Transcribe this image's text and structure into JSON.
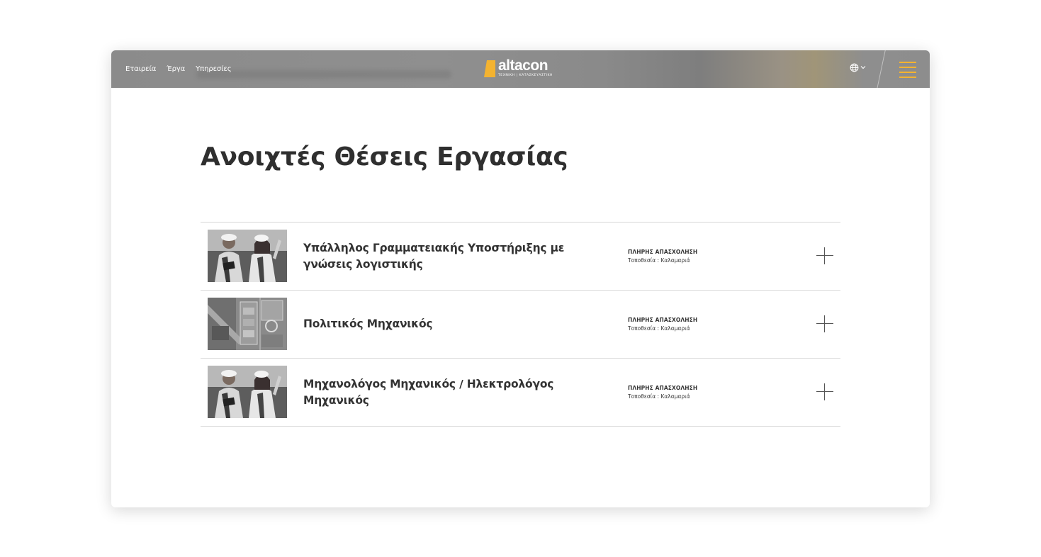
{
  "header": {
    "nav": [
      {
        "label": "Εταιρεία"
      },
      {
        "label": "Έργα"
      },
      {
        "label": "Υπηρεσίες"
      }
    ],
    "logo": {
      "word": "altacon",
      "tagline": "ΤΕΧΝΙΚΗ | ΚΑΤΑΣΚΕΥΑΣΤΙΚΗ"
    },
    "language_icon": "globe-icon",
    "menu_icon": "hamburger-menu-icon"
  },
  "colors": {
    "accent": "#f4b330",
    "header_bg": "#8b8b8b",
    "title": "#2f2f2f",
    "divider": "#d9d9d9"
  },
  "main": {
    "title": "Ανοιχτές Θέσεις Εργασίας",
    "jobs": [
      {
        "title": "Υπάλληλος Γραμματειακής Υποστήριξης με γνώσεις λογιστικής",
        "type": "ΠΛΗΡΗΣ ΑΠΑΣΧΟΛΗΣΗ",
        "location": "Τοποθεσία : Καλαμαριά",
        "image": "engineers-photo",
        "expand_icon": "plus-icon"
      },
      {
        "title": "Πολιτικός Μηχανικός",
        "type": "ΠΛΗΡΗΣ ΑΠΑΣΧΟΛΗΣΗ",
        "location": "Τοποθεσία : Καλαμαριά",
        "image": "aerial-site-photo",
        "expand_icon": "plus-icon"
      },
      {
        "title": "Μηχανολόγος Μηχανικός / Ηλεκτρολόγος Μηχανικός",
        "type": "ΠΛΗΡΗΣ ΑΠΑΣΧΟΛΗΣΗ",
        "location": "Τοποθεσία : Καλαμαριά",
        "image": "engineers-photo",
        "expand_icon": "plus-icon"
      }
    ]
  }
}
